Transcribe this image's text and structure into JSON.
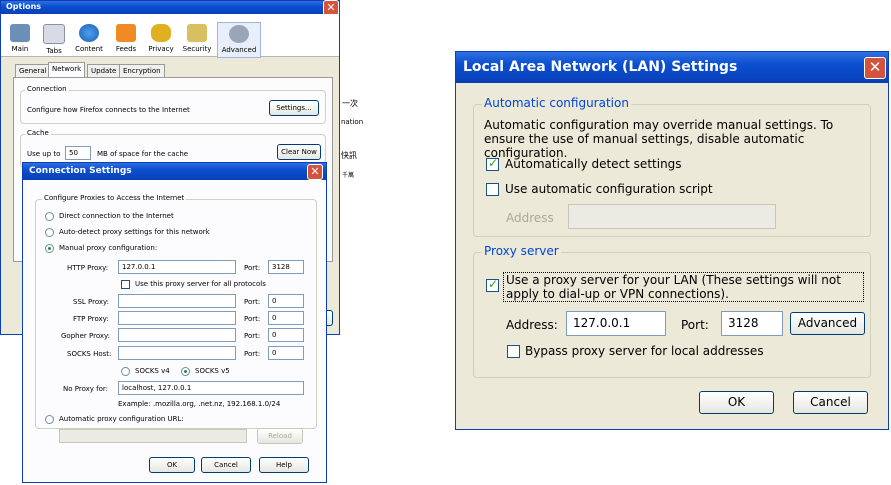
{
  "options": {
    "title": "Options",
    "toolbar": [
      "Main",
      "Tabs",
      "Content",
      "Feeds",
      "Privacy",
      "Security",
      "Advanced"
    ],
    "tabs": [
      "General",
      "Network",
      "Update",
      "Encryption"
    ],
    "connection": {
      "group": "Connection",
      "text": "Configure how Firefox connects to the Internet",
      "button": "Settings..."
    },
    "cache": {
      "group": "Cache",
      "use_up_to": "Use up to",
      "value": "50",
      "suffix": "MB of space for the cache",
      "button": "Clear Now"
    }
  },
  "bg_fragments": {
    "right_col": [
      "一次",
      "nation",
      "快訊",
      "千萬"
    ]
  },
  "conn": {
    "title": "Connection Settings",
    "group": "Configure Proxies to Access the Internet",
    "direct": "Direct connection to the Internet",
    "auto_detect": "Auto-detect proxy settings for this network",
    "manual": "Manual proxy configuration:",
    "http_label": "HTTP Proxy:",
    "http_value": "127.0.0.1",
    "port_label": "Port:",
    "http_port": "3128",
    "same_proxy": "Use this proxy server for all protocols",
    "ssl_label": "SSL Proxy:",
    "ftp_label": "FTP Proxy:",
    "gopher_label": "Gopher Proxy:",
    "socks_label": "SOCKS Host:",
    "zero": "0",
    "socks4": "SOCKS v4",
    "socks5": "SOCKS v5",
    "no_proxy_label": "No Proxy for:",
    "no_proxy_value": "localhost, 127.0.0.1",
    "example": "Example: .mozilla.org, .net.nz, 192.168.1.0/24",
    "auto_url": "Automatic proxy configuration URL:",
    "reload": "Reload",
    "ok": "OK",
    "cancel": "Cancel",
    "help": "Help"
  },
  "lan": {
    "title": "Local Area Network (LAN) Settings",
    "auto_group": "Automatic configuration",
    "auto_desc": "Automatic configuration may override manual settings.  To ensure the use of manual settings, disable automatic configuration.",
    "detect": "Automatically detect settings",
    "script": "Use automatic configuration script",
    "address_label": "Address",
    "proxy_group": "Proxy server",
    "use_proxy": "Use a proxy server for your LAN (These settings will not apply to dial-up or VPN connections).",
    "addr_label": "Address:",
    "addr_value": "127.0.0.1",
    "port_label": "Port:",
    "port_value": "3128",
    "advanced": "Advanced",
    "bypass": "Bypass proxy server for local addresses",
    "ok": "OK",
    "cancel": "Cancel"
  },
  "colors": {
    "xp_blue": "#0b4fd0",
    "dialog_bg": "#ece9d8",
    "close_red": "#d4533d"
  }
}
